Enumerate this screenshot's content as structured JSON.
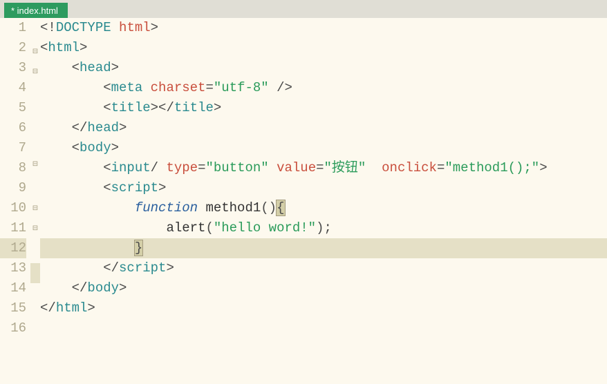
{
  "tab": {
    "label": "* index.html"
  },
  "gutter": [
    "1",
    "2",
    "3",
    "4",
    "5",
    "6",
    "7",
    "8",
    "9",
    "10",
    "11",
    "12",
    "13",
    "14",
    "15",
    "16"
  ],
  "fold": [
    "",
    "⊟",
    "⊟",
    "",
    "",
    "",
    "⊟",
    "",
    "⊟",
    "⊟",
    "",
    "",
    "",
    "",
    "",
    ""
  ],
  "highlight_line_index": 11,
  "code": {
    "l1": [
      [
        "c-punc",
        "<!"
      ],
      [
        "c-tag",
        "DOCTYPE"
      ],
      [
        "c-txt",
        " "
      ],
      [
        "c-attr",
        "html"
      ],
      [
        "c-punc",
        ">"
      ]
    ],
    "l2": [
      [
        "c-punc",
        "<"
      ],
      [
        "c-tag",
        "html"
      ],
      [
        "c-punc",
        ">"
      ]
    ],
    "l3": [
      [
        "c-txt",
        "    "
      ],
      [
        "c-punc",
        "<"
      ],
      [
        "c-tag",
        "head"
      ],
      [
        "c-punc",
        ">"
      ]
    ],
    "l4": [
      [
        "c-txt",
        "        "
      ],
      [
        "c-punc",
        "<"
      ],
      [
        "c-tag",
        "meta"
      ],
      [
        "c-txt",
        " "
      ],
      [
        "c-attr",
        "charset"
      ],
      [
        "c-punc",
        "="
      ],
      [
        "c-str",
        "\"utf-8\""
      ],
      [
        "c-txt",
        " "
      ],
      [
        "c-punc",
        "/>"
      ]
    ],
    "l5": [
      [
        "c-txt",
        "        "
      ],
      [
        "c-punc",
        "<"
      ],
      [
        "c-tag",
        "title"
      ],
      [
        "c-punc",
        "></"
      ],
      [
        "c-tag",
        "title"
      ],
      [
        "c-punc",
        ">"
      ]
    ],
    "l6": [
      [
        "c-txt",
        "    "
      ],
      [
        "c-punc",
        "</"
      ],
      [
        "c-tag",
        "head"
      ],
      [
        "c-punc",
        ">"
      ]
    ],
    "l7": [
      [
        "c-txt",
        "    "
      ],
      [
        "c-punc",
        "<"
      ],
      [
        "c-tag",
        "body"
      ],
      [
        "c-punc",
        ">"
      ]
    ],
    "l8": [
      [
        "c-txt",
        "        "
      ],
      [
        "c-punc",
        "<"
      ],
      [
        "c-tag",
        "input"
      ],
      [
        "c-punc",
        "/"
      ],
      [
        "c-txt",
        " "
      ],
      [
        "c-attr",
        "type"
      ],
      [
        "c-punc",
        "="
      ],
      [
        "c-str",
        "\"button\""
      ],
      [
        "c-txt",
        " "
      ],
      [
        "c-attr",
        "value"
      ],
      [
        "c-punc",
        "="
      ],
      [
        "c-str",
        "\"按钮\""
      ],
      [
        "c-txt",
        "  "
      ],
      [
        "c-attr",
        "onclick"
      ],
      [
        "c-punc",
        "="
      ],
      [
        "c-str",
        "\"method1();\""
      ],
      [
        "c-punc",
        ">"
      ]
    ],
    "l9": [
      [
        "c-txt",
        "        "
      ],
      [
        "c-punc",
        "<"
      ],
      [
        "c-tag",
        "script"
      ],
      [
        "c-punc",
        ">"
      ]
    ],
    "l10": [
      [
        "c-txt",
        "            "
      ],
      [
        "c-kw",
        "function"
      ],
      [
        "c-txt",
        " "
      ],
      [
        "c-fn",
        "method1"
      ],
      [
        "c-punc",
        "()"
      ],
      [
        "brace-hl c-punc",
        "{"
      ]
    ],
    "l11": [
      [
        "c-txt",
        "                "
      ],
      [
        "c-fn",
        "alert"
      ],
      [
        "c-punc",
        "("
      ],
      [
        "c-str",
        "\"hello word!\""
      ],
      [
        "c-punc",
        ");"
      ]
    ],
    "l12": [
      [
        "c-txt",
        "            "
      ],
      [
        "brace-hl c-punc",
        "}"
      ]
    ],
    "l13": [
      [
        "c-txt",
        "        "
      ],
      [
        "c-punc",
        "</"
      ],
      [
        "c-tag",
        "script"
      ],
      [
        "c-punc",
        ">"
      ]
    ],
    "l14": [
      [
        "c-txt",
        "    "
      ],
      [
        "c-punc",
        "</"
      ],
      [
        "c-tag",
        "body"
      ],
      [
        "c-punc",
        ">"
      ]
    ],
    "l15": [
      [
        "c-punc",
        "</"
      ],
      [
        "c-tag",
        "html"
      ],
      [
        "c-punc",
        ">"
      ]
    ],
    "l16": [
      [
        "c-txt",
        ""
      ]
    ]
  }
}
